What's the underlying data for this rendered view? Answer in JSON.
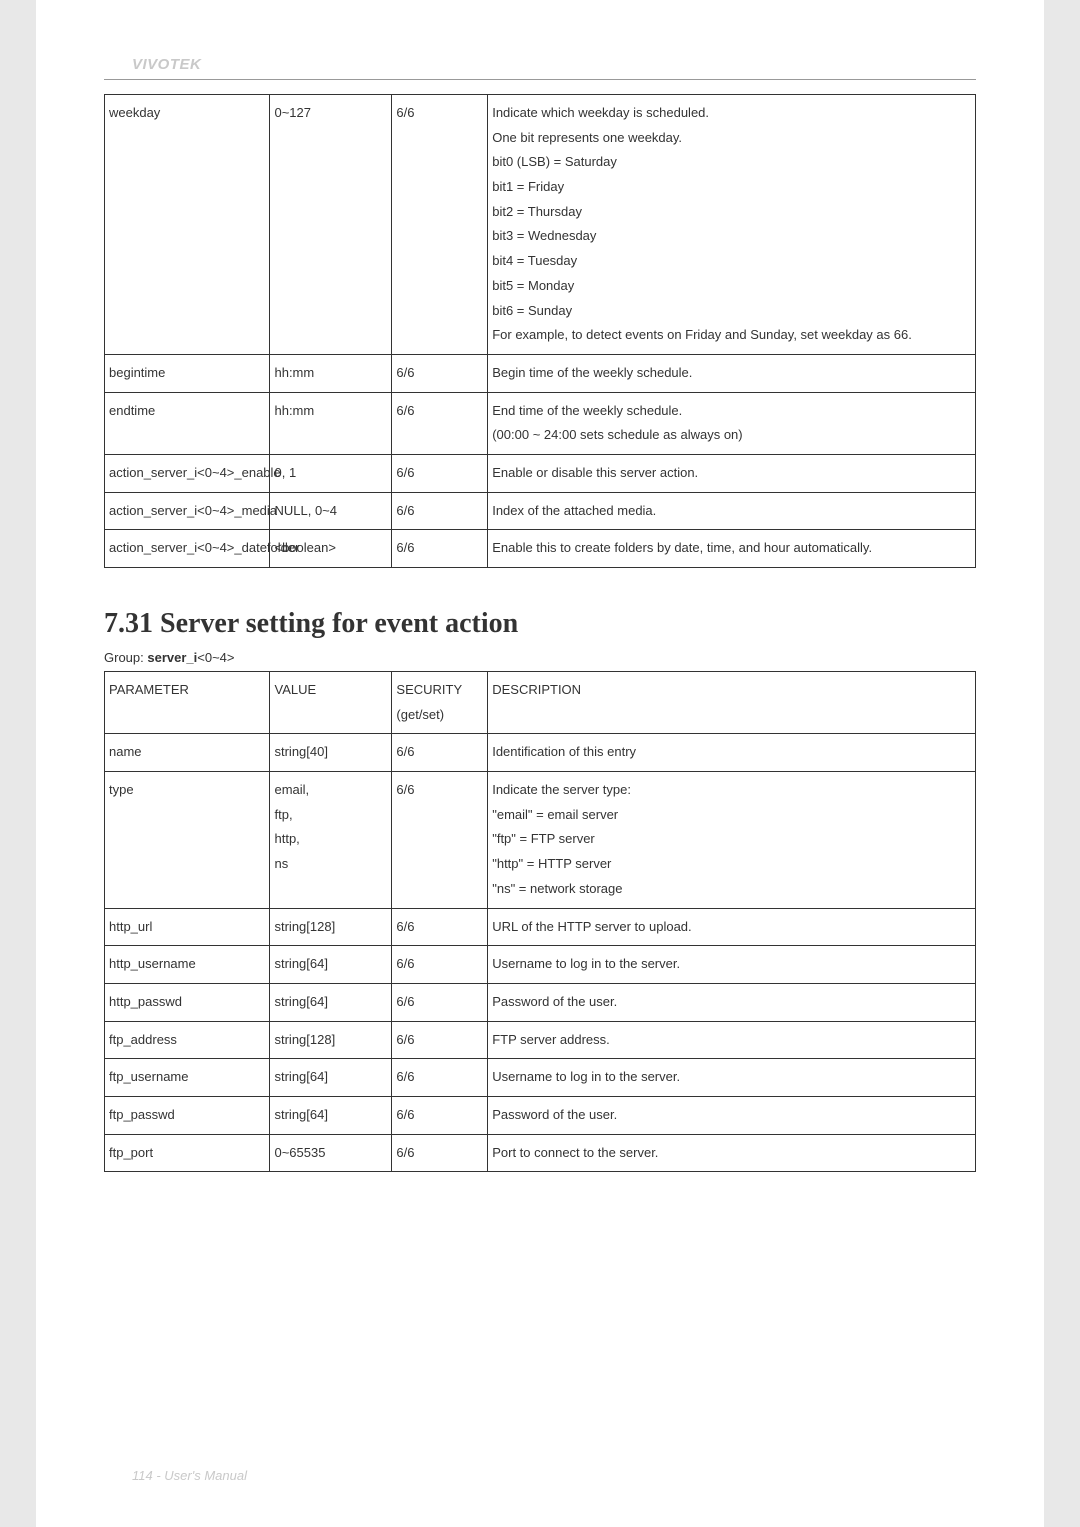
{
  "brand": "VIVOTEK",
  "footer": "114 - User's Manual",
  "table1": {
    "rows": [
      {
        "param": "weekday",
        "value": "0~127",
        "sec": "6/6",
        "desc": "Indicate which weekday is scheduled.\nOne bit represents one weekday.\nbit0 (LSB) = Saturday\nbit1 = Friday\nbit2 = Thursday\nbit3 = Wednesday\nbit4 = Tuesday\nbit5 = Monday\nbit6 = Sunday\nFor example, to detect events on Friday and Sunday, set weekday as 66."
      },
      {
        "param": "begintime",
        "value": "hh:mm",
        "sec": "6/6",
        "desc": "Begin time of the weekly schedule."
      },
      {
        "param": "endtime",
        "value": "hh:mm",
        "sec": "6/6",
        "desc": "End time of the weekly schedule.\n(00:00 ~ 24:00 sets schedule as always on)"
      },
      {
        "param": "action_server_i<0~4>_enable",
        "value": "0, 1",
        "sec": "6/6",
        "desc": "Enable or disable this server action."
      },
      {
        "param": "action_server_i<0~4>_media",
        "value": "NULL, 0~4",
        "sec": "6/6",
        "desc": "Index of the attached media."
      },
      {
        "param": "action_server_i<0~4>_datefolder",
        "value": "<boolean>",
        "sec": "6/6",
        "desc": "Enable this to create folders by date, time, and hour automatically."
      }
    ]
  },
  "section": {
    "heading": "7.31 Server setting for event action",
    "group_prefix": "Group: ",
    "group_bold": "server_i",
    "group_suffix": "<0~4>"
  },
  "table2": {
    "header": {
      "param": "PARAMETER",
      "value": "VALUE",
      "sec": "SECURITY\n(get/set)",
      "desc": "DESCRIPTION"
    },
    "rows": [
      {
        "param": "name",
        "value": "string[40]",
        "sec": "6/6",
        "desc": "Identification of this entry"
      },
      {
        "param": "type",
        "value": "email,\nftp,\nhttp,\nns",
        "sec": "6/6",
        "desc": "Indicate the server type:\n\"email\" = email server\n\"ftp\" = FTP server\n\"http\" = HTTP server\n\"ns\" = network storage"
      },
      {
        "param": "http_url",
        "value": "string[128]",
        "sec": "6/6",
        "desc": "URL of the HTTP server to upload."
      },
      {
        "param": "http_username",
        "value": "string[64]",
        "sec": "6/6",
        "desc": "Username to log in to the server."
      },
      {
        "param": "http_passwd",
        "value": "string[64]",
        "sec": "6/6",
        "desc": "Password of the user."
      },
      {
        "param": "ftp_address",
        "value": "string[128]",
        "sec": "6/6",
        "desc": "FTP server address."
      },
      {
        "param": "ftp_username",
        "value": "string[64]",
        "sec": "6/6",
        "desc": "Username to log in to the server."
      },
      {
        "param": "ftp_passwd",
        "value": "string[64]",
        "sec": "6/6",
        "desc": "Password of the user."
      },
      {
        "param": "ftp_port",
        "value": "0~65535",
        "sec": "6/6",
        "desc": "Port to connect to the server."
      }
    ]
  }
}
